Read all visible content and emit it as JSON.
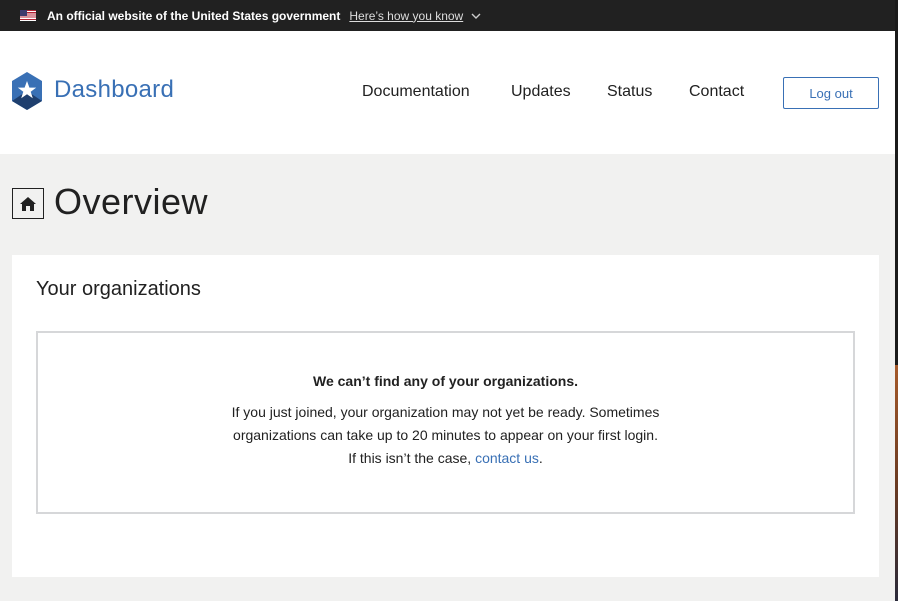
{
  "gov_banner": {
    "flag_icon": "us-flag-icon",
    "text": "An official website of the United States government",
    "link": "Here’s how you know",
    "chevron_icon": "chevron-down-icon"
  },
  "header": {
    "brand": "Dashboard",
    "logo_icon": "star-hexagon-logo-icon",
    "nav": [
      "Documentation",
      "Updates",
      "Status",
      "Contact"
    ],
    "logout_label": "Log out"
  },
  "page": {
    "home_icon": "home-icon",
    "title": "Overview"
  },
  "organizations": {
    "heading": "Your organizations",
    "empty_title": "We can’t find any of your organizations.",
    "empty_line1": "If you just joined, your organization may not yet be ready. Sometimes",
    "empty_line2": "organizations can take up to 20 minutes to appear on your first login.",
    "empty_line3_prefix": "If this isn’t the case, ",
    "contact_link": "contact us",
    "empty_line3_suffix": "."
  },
  "colors": {
    "accent": "#3970b5",
    "banner_bg": "#212121",
    "page_bg": "#f1f1f0"
  }
}
